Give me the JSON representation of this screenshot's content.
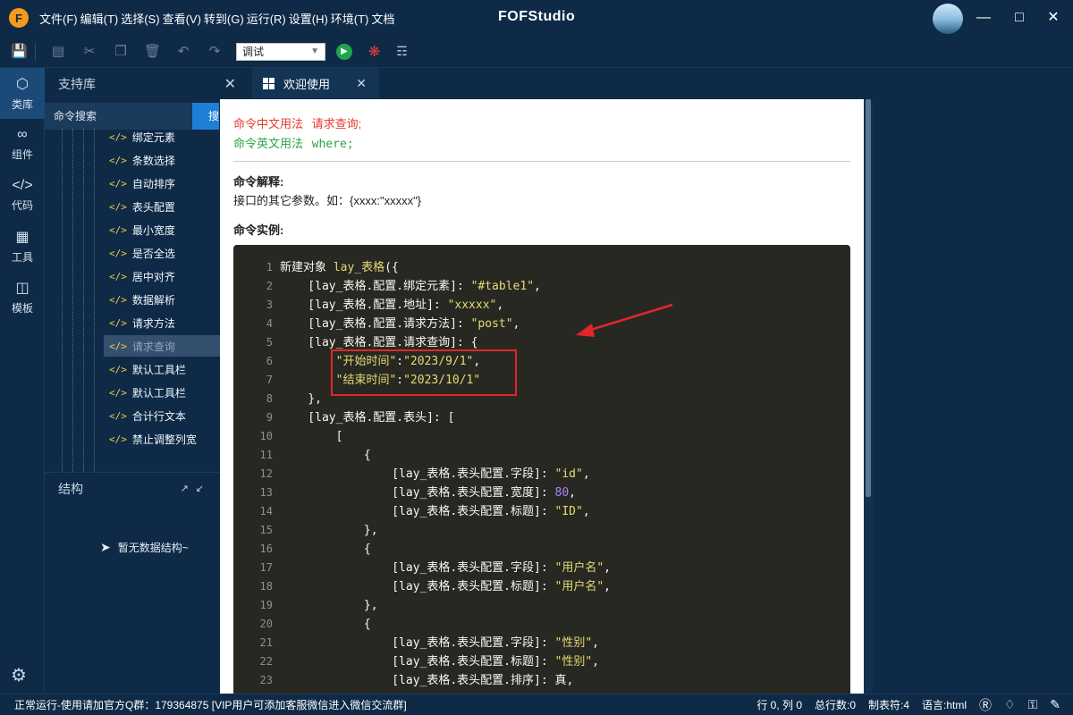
{
  "app": {
    "logo_letter": "F",
    "title": "FOFStudio",
    "menus": [
      "文件(F)",
      "编辑(T)",
      "选择(S)",
      "查看(V)",
      "转到(G)",
      "运行(R)",
      "设置(H)",
      "环境(T)",
      "文档"
    ]
  },
  "toolbar": {
    "mode_select": "调试",
    "icons": [
      "save-icon",
      "new-file-icon",
      "cut-icon",
      "copy-icon",
      "delete-icon",
      "undo-icon",
      "redo-icon"
    ]
  },
  "activity": [
    {
      "label": "类库",
      "icon": "cube-icon"
    },
    {
      "label": "组件",
      "icon": "link-icon"
    },
    {
      "label": "代码",
      "icon": "code-icon"
    },
    {
      "label": "工具",
      "icon": "tools-icon"
    },
    {
      "label": "模板",
      "icon": "template-icon"
    }
  ],
  "sidepanel": {
    "title": "支持库",
    "search_placeholder": "命令搜索",
    "search_button": "搜索",
    "tree_items": [
      "绑定元素",
      "条数选择",
      "自动排序",
      "表头配置",
      "最小宽度",
      "是否全选",
      "居中对齐",
      "数据解析",
      "请求方法",
      "请求查询",
      "默认工具栏",
      "默认工具栏",
      "合计行文本",
      "禁止调整列宽"
    ],
    "selected_index": 9,
    "structure_title": "结构",
    "no_structure": "暂无数据结构~"
  },
  "editor": {
    "tab_label": "欢迎使用"
  },
  "doc": {
    "cn_usage_label": "命令中文用法",
    "cn_usage_value": "请求查询;",
    "en_usage_label": "命令英文用法",
    "en_usage_value": "where;",
    "explain_title": "命令解释:",
    "explain_text": "接口的其它参数。如：{xxxx:\"xxxxx\"}",
    "example_title": "命令实例:"
  },
  "code_lines": [
    "新建对象 lay_表格({",
    "    [lay_表格.配置.绑定元素]: \"#table1\",",
    "    [lay_表格.配置.地址]: \"xxxxx\",",
    "    [lay_表格.配置.请求方法]: \"post\",",
    "    [lay_表格.配置.请求查询]: {",
    "        \"开始时间\":\"2023/9/1\",",
    "        \"结束时间\":\"2023/10/1\"",
    "    },",
    "    [lay_表格.配置.表头]: [",
    "        [",
    "            {",
    "                [lay_表格.表头配置.字段]: \"id\",",
    "                [lay_表格.表头配置.宽度]: 80,",
    "                [lay_表格.表头配置.标题]: \"ID\",",
    "            },",
    "            {",
    "                [lay_表格.表头配置.字段]: \"用户名\",",
    "                [lay_表格.表头配置.标题]: \"用户名\",",
    "            },",
    "            {",
    "                [lay_表格.表头配置.字段]: \"性别\",",
    "                [lay_表格.表头配置.标题]: \"性别\",",
    "                [lay_表格.表头配置.排序]: 真,"
  ],
  "status": {
    "left": "正常运行-使用请加官方Q群：179364875 [VIP用户可添加客服微信进入微信交流群]",
    "position": "行 0, 列 0",
    "total_lines": "总行数:0",
    "tab_size": "制表符:4",
    "language": "语言:html"
  },
  "colors": {
    "bg": "#0e2a47",
    "accent": "#1e7fd6",
    "red": "#e43c2f",
    "green": "#2aa541"
  }
}
